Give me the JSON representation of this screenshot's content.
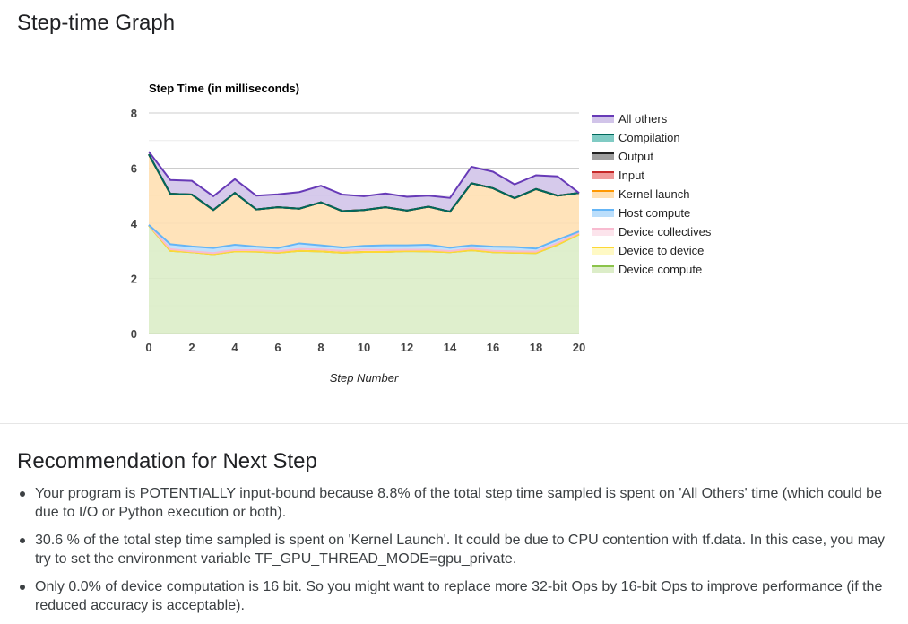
{
  "page": {
    "step_time_title": "Step-time Graph",
    "recommendation_title": "Recommendation for Next Step"
  },
  "chart_data": {
    "type": "area",
    "title": "Step Time (in milliseconds)",
    "xlabel": "Step Number",
    "ylabel": "",
    "stacked": true,
    "grid": true,
    "legend_position": "right",
    "x": [
      0,
      1,
      2,
      3,
      4,
      5,
      6,
      7,
      8,
      9,
      10,
      11,
      12,
      13,
      14,
      15,
      16,
      17,
      18,
      19,
      20
    ],
    "xlim": [
      0,
      20
    ],
    "ylim": [
      0,
      8
    ],
    "x_ticks": [
      "0",
      "2",
      "4",
      "6",
      "8",
      "10",
      "12",
      "14",
      "16",
      "18",
      "20"
    ],
    "y_ticks": [
      "0",
      "2",
      "4",
      "6",
      "8"
    ],
    "series": [
      {
        "name": "Device compute",
        "line": "#8bc34a",
        "fill": "#dcedc8",
        "values": [
          3.92,
          3.0,
          2.95,
          2.88,
          2.98,
          2.97,
          2.93,
          3.0,
          2.98,
          2.93,
          2.96,
          2.96,
          2.99,
          2.98,
          2.95,
          3.02,
          2.95,
          2.93,
          2.92,
          3.22,
          3.6
        ]
      },
      {
        "name": "Device to device",
        "line": "#fdd835",
        "fill": "#fff9c4",
        "values": [
          0,
          0,
          0,
          0,
          0,
          0,
          0,
          0,
          0,
          0,
          0,
          0,
          0,
          0,
          0,
          0,
          0,
          0,
          0,
          0,
          0
        ]
      },
      {
        "name": "Device collectives",
        "line": "#f8bbd0",
        "fill": "#fce4ec",
        "values": [
          0.02,
          0.06,
          0.03,
          0.04,
          0.05,
          0.05,
          0.05,
          0.07,
          0.07,
          0.07,
          0.08,
          0.07,
          0.05,
          0.06,
          0.04,
          0.06,
          0.05,
          0.05,
          0.05,
          0.06,
          0.05
        ]
      },
      {
        "name": "Host compute",
        "line": "#64b5f6",
        "fill": "#bbdefb",
        "values": [
          0,
          0.18,
          0.18,
          0.18,
          0.19,
          0.13,
          0.12,
          0.2,
          0.15,
          0.12,
          0.14,
          0.17,
          0.16,
          0.18,
          0.12,
          0.12,
          0.15,
          0.16,
          0.11,
          0.12,
          0.05
        ]
      },
      {
        "name": "Kernel launch",
        "line": "#ff9800",
        "fill": "#ffe0b2",
        "values": [
          2.56,
          1.83,
          1.88,
          1.38,
          1.88,
          1.35,
          1.48,
          1.26,
          1.56,
          1.32,
          1.3,
          1.38,
          1.26,
          1.38,
          1.31,
          2.25,
          2.12,
          1.77,
          2.16,
          1.6,
          1.4
        ]
      },
      {
        "name": "Input",
        "line": "#c62828",
        "fill": "#ef9a9a",
        "values": [
          0,
          0,
          0,
          0,
          0,
          0,
          0,
          0,
          0,
          0,
          0,
          0,
          0,
          0,
          0,
          0,
          0,
          0,
          0,
          0,
          0
        ]
      },
      {
        "name": "Output",
        "line": "#212121",
        "fill": "#9e9e9e",
        "values": [
          0,
          0,
          0,
          0,
          0,
          0,
          0,
          0,
          0,
          0,
          0,
          0,
          0,
          0,
          0,
          0,
          0,
          0,
          0,
          0,
          0
        ]
      },
      {
        "name": "Compilation",
        "line": "#00695c",
        "fill": "#80cbc4",
        "values": [
          0,
          0,
          0,
          0,
          0,
          0,
          0,
          0,
          0,
          0,
          0,
          0,
          0,
          0,
          0,
          0,
          0,
          0,
          0,
          0,
          0
        ]
      },
      {
        "name": "All others",
        "line": "#673ab7",
        "fill": "#d1c4e9",
        "values": [
          0.1,
          0.5,
          0.5,
          0.5,
          0.5,
          0.5,
          0.47,
          0.6,
          0.6,
          0.6,
          0.5,
          0.5,
          0.5,
          0.4,
          0.5,
          0.6,
          0.6,
          0.5,
          0.5,
          0.7,
          0.0
        ]
      }
    ],
    "legend_order": [
      "All others",
      "Compilation",
      "Output",
      "Input",
      "Kernel launch",
      "Host compute",
      "Device collectives",
      "Device to device",
      "Device compute"
    ]
  },
  "recommendations": [
    "Your program is POTENTIALLY input-bound because 8.8% of the total step time sampled is spent on 'All Others' time (which could be due to I/O or Python execution or both).",
    "30.6 % of the total step time sampled is spent on 'Kernel Launch'. It could be due to CPU contention with tf.data. In this case, you may try to set the environment variable TF_GPU_THREAD_MODE=gpu_private.",
    "Only 0.0% of device computation is 16 bit. So you might want to replace more 32-bit Ops by 16-bit Ops to improve performance (if the reduced accuracy is acceptable)."
  ]
}
